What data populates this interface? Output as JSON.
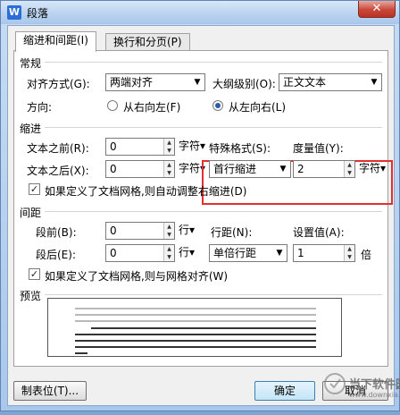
{
  "window": {
    "title": "段落",
    "app_icon": "W",
    "close": "✕"
  },
  "tabs": [
    {
      "label": "缩进和间距(I)",
      "active": true
    },
    {
      "label": "换行和分页(P)",
      "active": false
    }
  ],
  "general": {
    "section": "常规",
    "alignment_label": "对齐方式(G):",
    "alignment_value": "两端对齐",
    "outline_label": "大纲级别(O):",
    "outline_value": "正文文本",
    "direction_label": "方向:",
    "rtl_label": "从右向左(F)",
    "ltr_label": "从左向右(L)"
  },
  "indent": {
    "section": "缩进",
    "before_label": "文本之前(R):",
    "before_value": "0",
    "before_unit": "字符▾",
    "after_label": "文本之后(X):",
    "after_value": "0",
    "after_unit": "字符▾",
    "special_label": "特殊格式(S):",
    "special_value": "首行缩进",
    "measure_label": "度量值(Y):",
    "measure_value": "2",
    "measure_unit": "字符▾",
    "grid_check_label": "如果定义了文档网格,则自动调整右缩进(D)"
  },
  "spacing": {
    "section": "间距",
    "before_label": "段前(B):",
    "before_value": "0",
    "before_unit": "行▾",
    "after_label": "段后(E):",
    "after_value": "0",
    "after_unit": "行▾",
    "line_label": "行距(N):",
    "line_value": "单倍行距",
    "setting_label": "设置值(A):",
    "setting_value": "1",
    "setting_unit": "倍",
    "grid_check_label": "如果定义了文档网格,则与网格对齐(W)"
  },
  "preview": {
    "section": "预览"
  },
  "buttons": {
    "tabs": "制表位(T)...",
    "ok": "确定",
    "cancel": "取消"
  },
  "watermark": {
    "name": "当下软件园",
    "url": "www.downxia.com"
  },
  "colors": {
    "highlight": "#e03030",
    "title_bar": "#bfd6f1"
  }
}
